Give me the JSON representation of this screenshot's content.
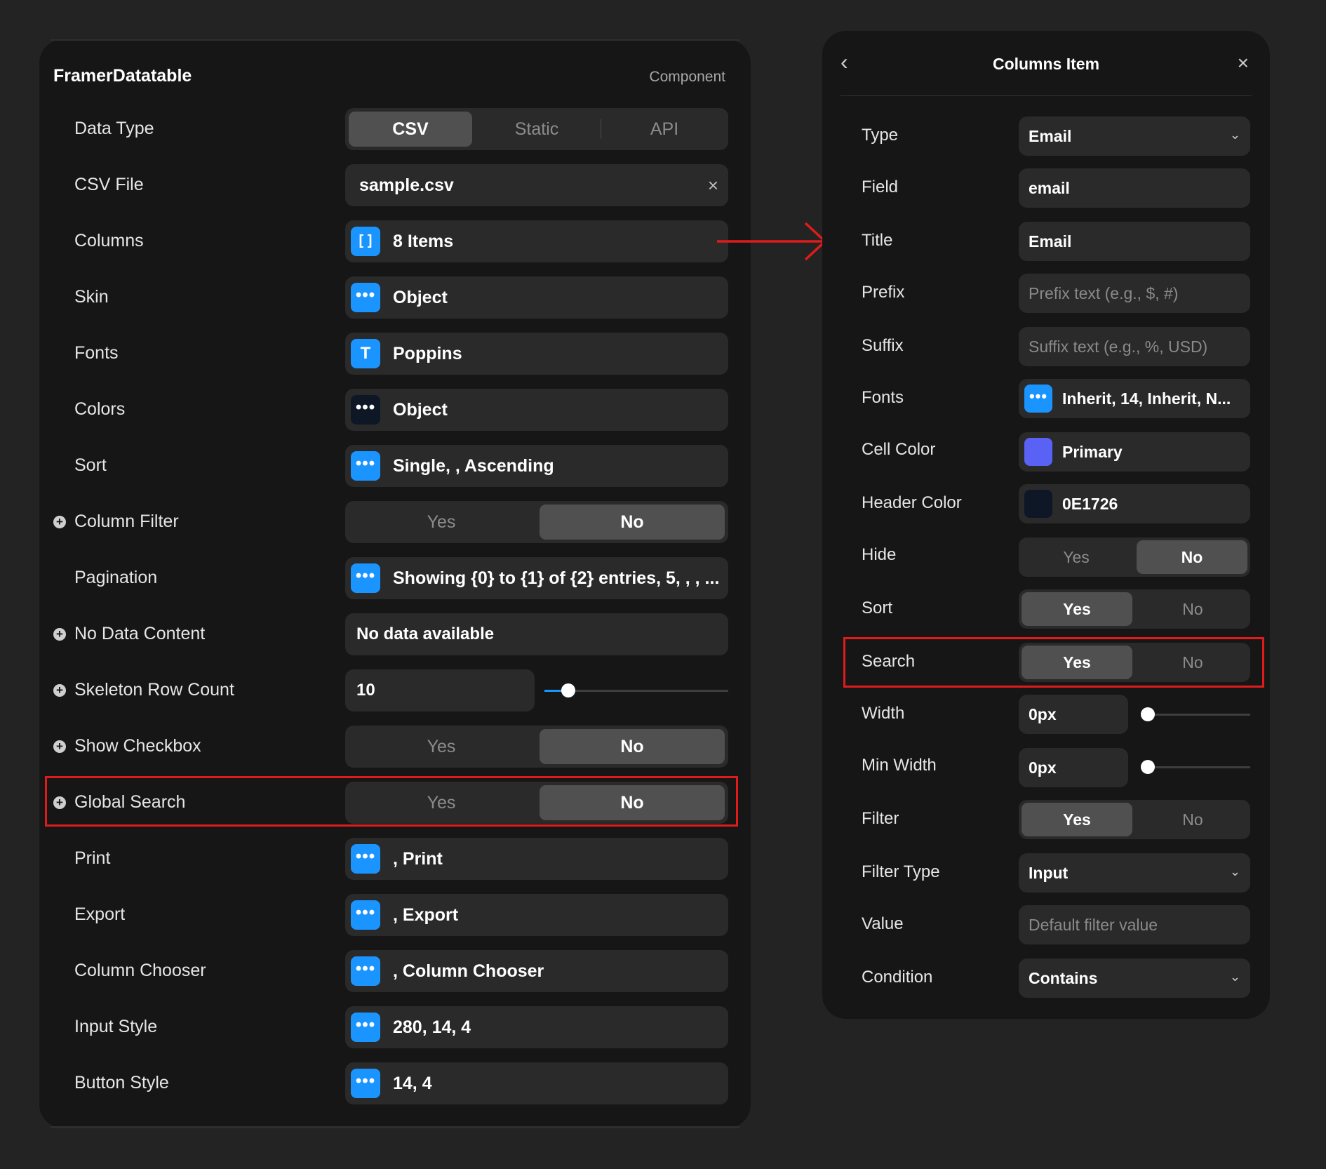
{
  "left_panel": {
    "title": "FramerDatatable",
    "meta": "Component",
    "rows": {
      "data_type": {
        "label": "Data Type",
        "options": [
          "CSV",
          "Static",
          "API"
        ],
        "selected": "CSV"
      },
      "csv_file": {
        "label": "CSV File",
        "value": "sample.csv",
        "clear_icon": "×"
      },
      "columns": {
        "label": "Columns",
        "value": "8 Items",
        "icon": "[ ]"
      },
      "skin": {
        "label": "Skin",
        "value": "Object",
        "icon": "•••"
      },
      "fonts": {
        "label": "Fonts",
        "value": "Poppins",
        "icon": "T"
      },
      "colors": {
        "label": "Colors",
        "value": "Object",
        "icon": "•••"
      },
      "sort": {
        "label": "Sort",
        "value": "Single, , Ascending",
        "icon": "•••"
      },
      "column_filter": {
        "label": "Column Filter",
        "yes": "Yes",
        "no": "No",
        "selected": "No"
      },
      "pagination": {
        "label": "Pagination",
        "value": "Showing {0} to {1} of {2} entries, 5, , , ...",
        "icon": "•••"
      },
      "no_data_content": {
        "label": "No Data Content",
        "value": "No data available"
      },
      "skeleton_row_count": {
        "label": "Skeleton Row Count",
        "value": "10",
        "slider_level": 0.13
      },
      "show_checkbox": {
        "label": "Show Checkbox",
        "yes": "Yes",
        "no": "No",
        "selected": "No"
      },
      "global_search": {
        "label": "Global Search",
        "yes": "Yes",
        "no": "No",
        "selected": "No"
      },
      "print": {
        "label": "Print",
        "value": ", Print",
        "icon": "•••"
      },
      "export": {
        "label": "Export",
        "value": ", Export",
        "icon": "•••"
      },
      "column_chooser": {
        "label": "Column Chooser",
        "value": ", Column Chooser",
        "icon": "•••"
      },
      "input_style": {
        "label": "Input Style",
        "value": "280, 14, 4",
        "icon": "•••"
      },
      "button_style": {
        "label": "Button Style",
        "value": "14, 4",
        "icon": "•••"
      }
    }
  },
  "right_panel": {
    "title": "Columns Item",
    "back_icon": "‹",
    "close_icon": "×",
    "rows": {
      "type": {
        "label": "Type",
        "value": "Email"
      },
      "field": {
        "label": "Field",
        "value": "email"
      },
      "title": {
        "label": "Title",
        "value": "Email"
      },
      "prefix": {
        "label": "Prefix",
        "placeholder": "Prefix text (e.g., $, #)"
      },
      "suffix": {
        "label": "Suffix",
        "placeholder": "Suffix text (e.g., %, USD)"
      },
      "fonts": {
        "label": "Fonts",
        "value": "Inherit, 14, Inherit, N...",
        "icon": "•••"
      },
      "cell_color": {
        "label": "Cell Color",
        "value": "Primary",
        "swatch": "#5a61f5"
      },
      "header_color": {
        "label": "Header Color",
        "value": "0E1726",
        "swatch": "#0e1726"
      },
      "hide": {
        "label": "Hide",
        "yes": "Yes",
        "no": "No",
        "selected": "No"
      },
      "sort": {
        "label": "Sort",
        "yes": "Yes",
        "no": "No",
        "selected": "Yes"
      },
      "search": {
        "label": "Search",
        "yes": "Yes",
        "no": "No",
        "selected": "Yes"
      },
      "width": {
        "label": "Width",
        "value": "0px",
        "slider_level": 0
      },
      "min_width": {
        "label": "Min Width",
        "value": "0px",
        "slider_level": 0
      },
      "filter": {
        "label": "Filter",
        "yes": "Yes",
        "no": "No",
        "selected": "Yes"
      },
      "filter_type": {
        "label": "Filter Type",
        "value": "Input"
      },
      "value": {
        "label": "Value",
        "placeholder": "Default filter value"
      },
      "condition": {
        "label": "Condition",
        "value": "Contains"
      }
    }
  },
  "colors": {
    "accent": "#1a94ff",
    "highlight": "#e01b1b",
    "panel_bg": "#161616",
    "control_bg": "#2a2a2a",
    "selected_segment": "#505050"
  }
}
